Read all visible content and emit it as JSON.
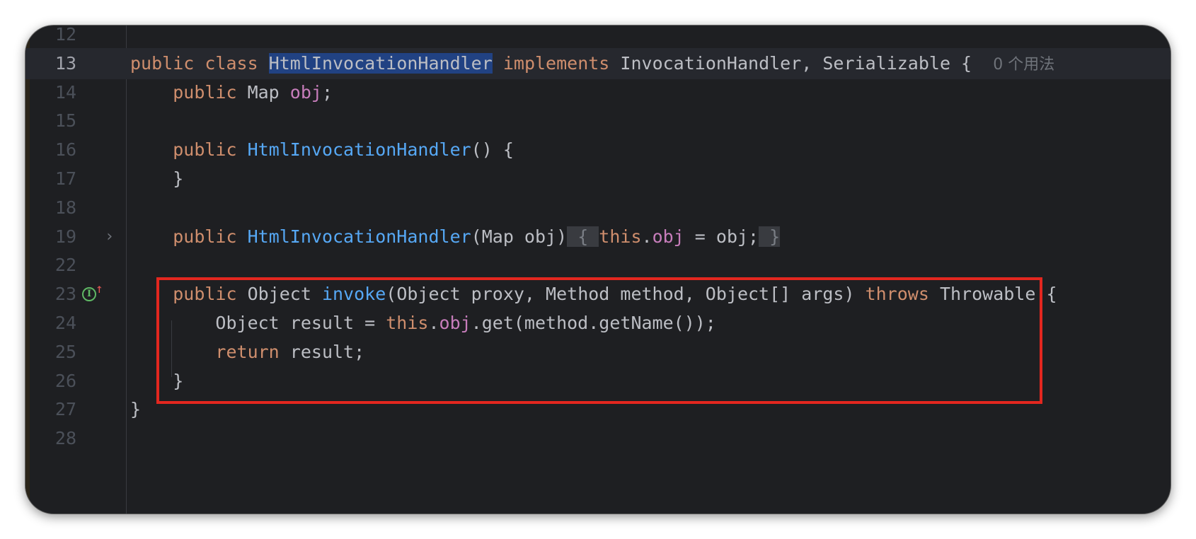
{
  "editor": {
    "lines": [
      {
        "num": "12",
        "segments": []
      },
      {
        "num": "13",
        "current": true,
        "segments": [
          {
            "t": "public",
            "c": "kw"
          },
          {
            "t": " "
          },
          {
            "t": "class",
            "c": "kw"
          },
          {
            "t": " "
          },
          {
            "t": "HtmlInvocationHandler",
            "c": "sel"
          },
          {
            "t": " "
          },
          {
            "t": "implements",
            "c": "kw"
          },
          {
            "t": " InvocationHandler, Serializable {  "
          },
          {
            "t": "0 个用法",
            "c": "hint"
          }
        ]
      },
      {
        "num": "14",
        "segments": [
          {
            "t": "    "
          },
          {
            "t": "public",
            "c": "kw"
          },
          {
            "t": " Map "
          },
          {
            "t": "obj",
            "c": "fld"
          },
          {
            "t": ";"
          }
        ]
      },
      {
        "num": "15",
        "segments": []
      },
      {
        "num": "16",
        "segments": [
          {
            "t": "    "
          },
          {
            "t": "public",
            "c": "kw"
          },
          {
            "t": " "
          },
          {
            "t": "HtmlInvocationHandler",
            "c": "fn"
          },
          {
            "t": "() {"
          }
        ]
      },
      {
        "num": "17",
        "segments": [
          {
            "t": "    }"
          }
        ]
      },
      {
        "num": "18",
        "segments": []
      },
      {
        "num": "19",
        "fold": true,
        "segments": [
          {
            "t": "    "
          },
          {
            "t": "public",
            "c": "kw"
          },
          {
            "t": " "
          },
          {
            "t": "HtmlInvocationHandler",
            "c": "fn"
          },
          {
            "t": "(Map obj)"
          },
          {
            "t": " { ",
            "c": "fold-box dim"
          },
          {
            "t": "this",
            "c": "kw"
          },
          {
            "t": "."
          },
          {
            "t": "obj",
            "c": "fld"
          },
          {
            "t": " = obj;"
          },
          {
            "t": " }",
            "c": "fold-box dim"
          }
        ]
      },
      {
        "num": "22",
        "segments": []
      },
      {
        "num": "23",
        "impl": true,
        "segments": [
          {
            "t": "    "
          },
          {
            "t": "public",
            "c": "kw"
          },
          {
            "t": " Object "
          },
          {
            "t": "invoke",
            "c": "fn"
          },
          {
            "t": "(Object proxy, Method method, Object[] args) "
          },
          {
            "t": "throws",
            "c": "kw"
          },
          {
            "t": " Throwable {"
          }
        ]
      },
      {
        "num": "24",
        "segments": [
          {
            "t": "        Object result = "
          },
          {
            "t": "this",
            "c": "kw"
          },
          {
            "t": "."
          },
          {
            "t": "obj",
            "c": "fld"
          },
          {
            "t": ".get(method.getName());"
          }
        ]
      },
      {
        "num": "25",
        "segments": [
          {
            "t": "        "
          },
          {
            "t": "return",
            "c": "kw"
          },
          {
            "t": " result;"
          }
        ]
      },
      {
        "num": "26",
        "segments": [
          {
            "t": "    }"
          }
        ]
      },
      {
        "num": "27",
        "segments": [
          {
            "t": "}"
          }
        ]
      },
      {
        "num": "28",
        "segments": []
      }
    ],
    "gutter_icons": {
      "impl_letter": "I",
      "impl_arrow": "↑",
      "fold_chevron": "›"
    },
    "colors": {
      "background": "#1e1f22",
      "keyword": "#cf8e6d",
      "function": "#56a8f5",
      "field": "#c77dbb",
      "selection": "#214283",
      "annotation_box": "#e3271f"
    }
  }
}
